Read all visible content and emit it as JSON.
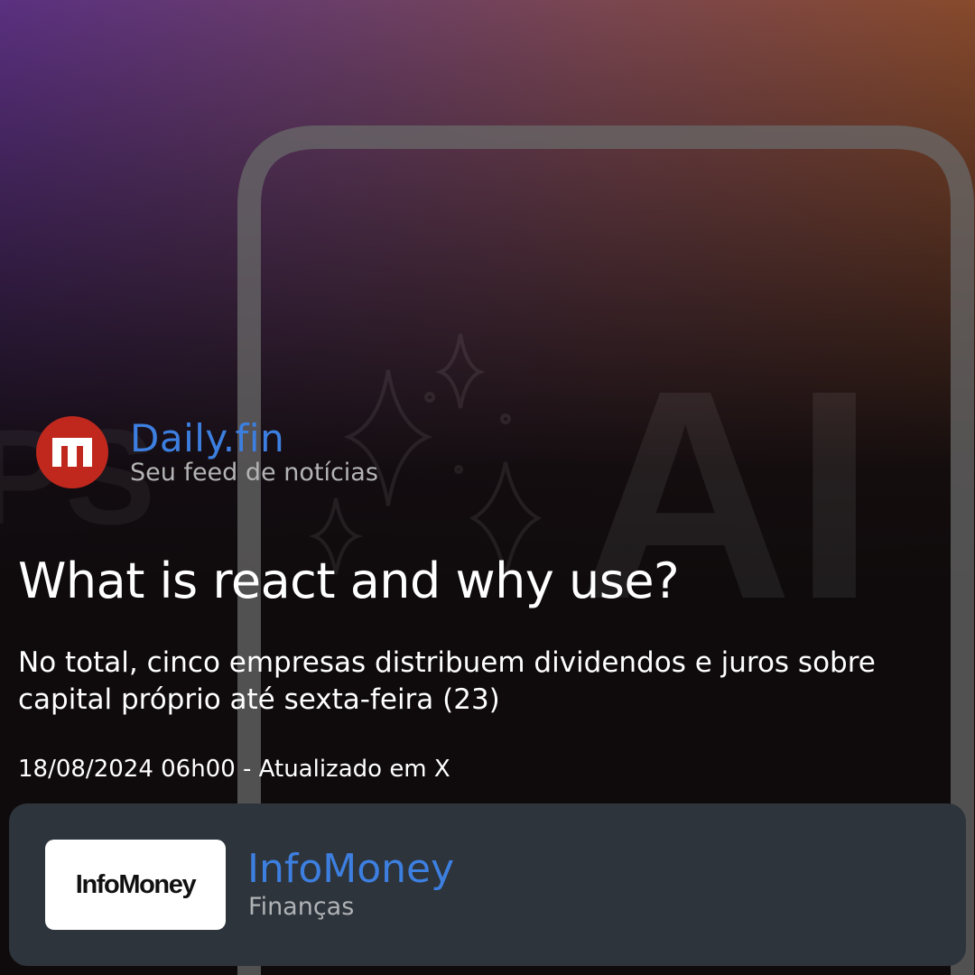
{
  "brand": {
    "name": "Daily.fin",
    "tagline": "Seu feed de notícias",
    "logo_letter": "m",
    "logo_icon": "daily-fin-logo-icon",
    "logo_color": "#c0281e",
    "name_color": "#3d7fe0"
  },
  "article": {
    "headline": "What is react and why use?",
    "summary": "No total, cinco empresas distribuem dividendos e juros sobre capital próprio até sexta-feira (23)",
    "meta": "18/08/2024 06h00 - Atualizado em X"
  },
  "background": {
    "overlay_text": "AI",
    "partial_text": "PS",
    "sparkle_icon": "sparkle-icon"
  },
  "source": {
    "logo_text": "InfoMoney",
    "name": "InfoMoney",
    "category": "Finanças",
    "panel_color": "#2d343b",
    "name_color": "#3d7fe0"
  }
}
